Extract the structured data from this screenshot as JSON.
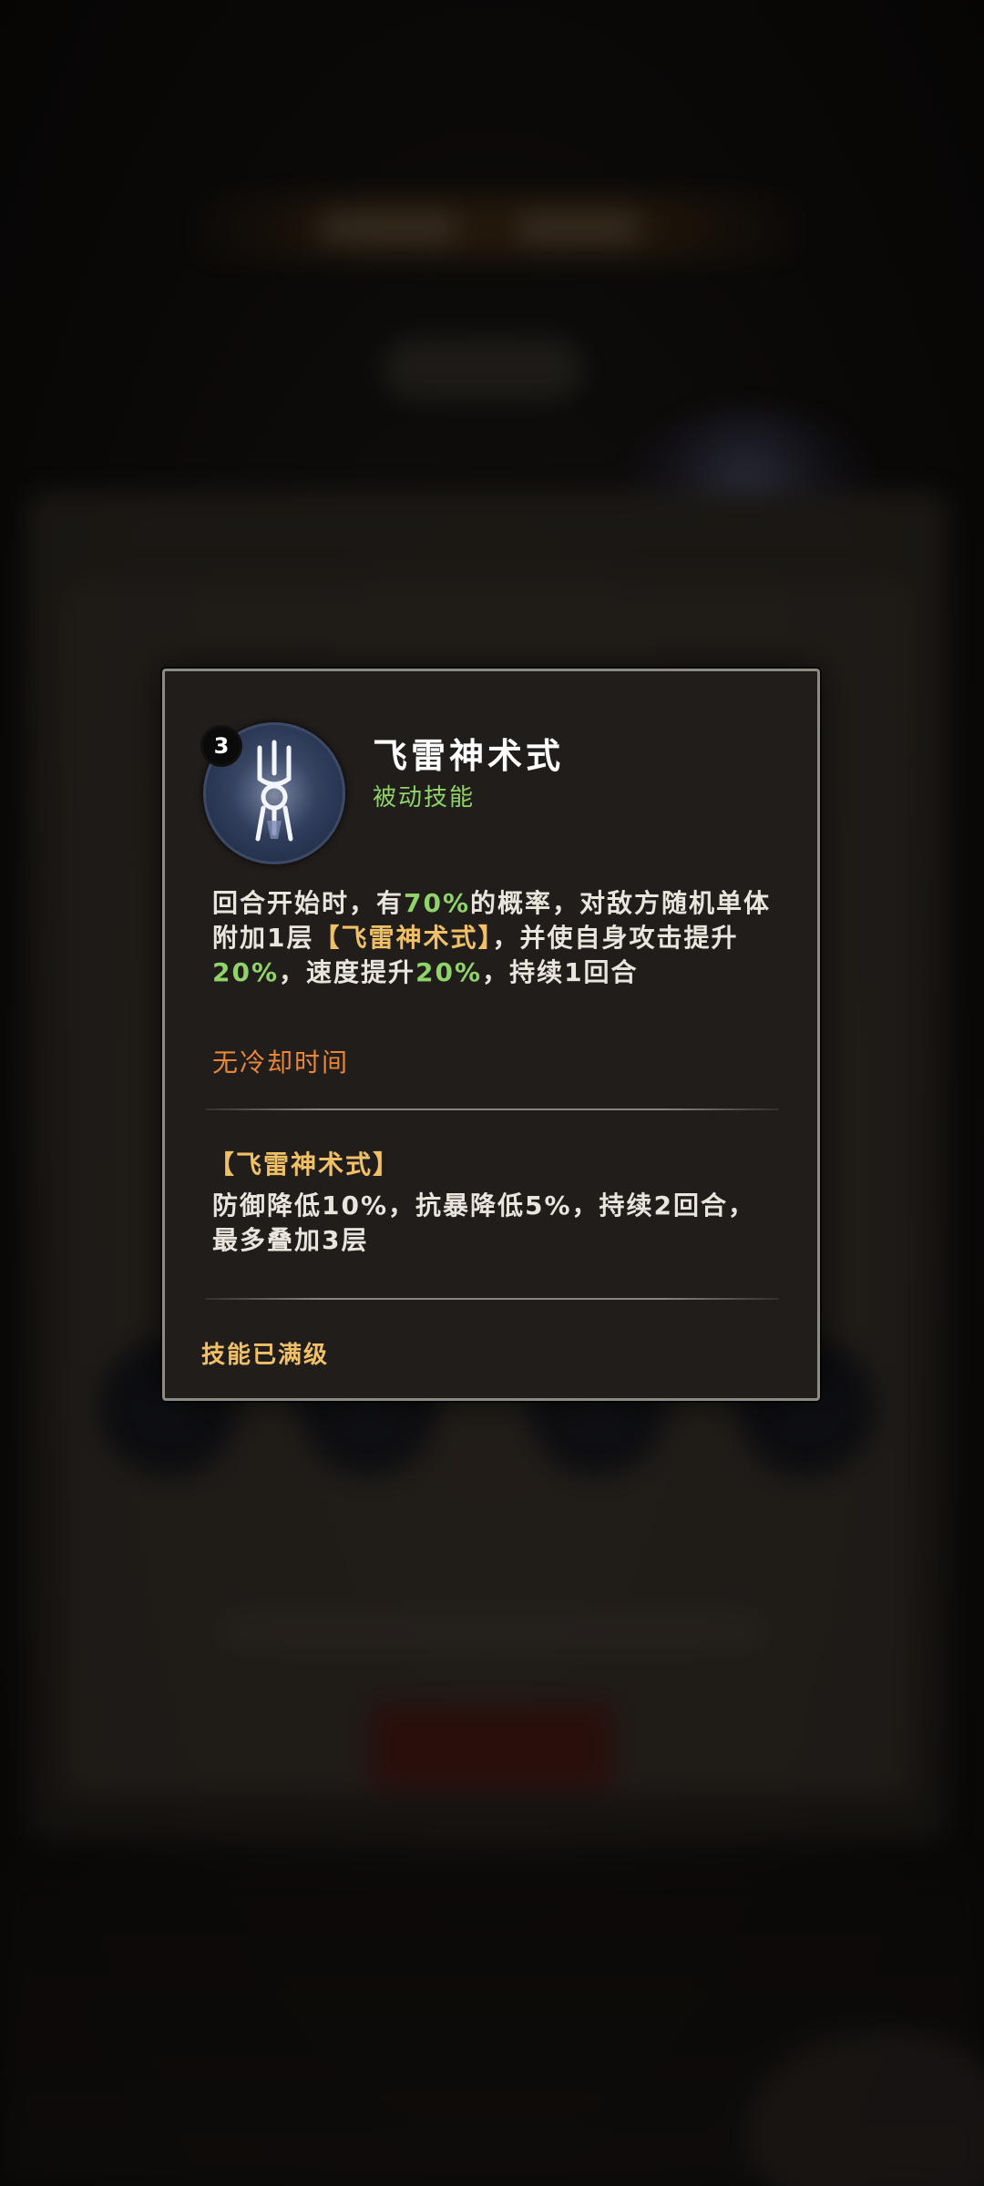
{
  "skill": {
    "level": "3",
    "name": "飞雷神术式",
    "type": "被动技能",
    "icon": "lightning-totem-icon",
    "description": {
      "p1": "回合开始时，有",
      "rate": "70%",
      "p2": "的概率，对敌方随机单体附加1层",
      "effect_tag": "【飞雷神术式】",
      "p3": "，并使自身攻击提升",
      "atk_up": "20%",
      "p4": "，速度提升",
      "spd_up": "20%",
      "p5": "，持续1回合"
    },
    "cooldown": "无冷却时间",
    "effect": {
      "name": "【飞雷神术式】",
      "description": "防御降低10%，抗暴降低5%，持续2回合，最多叠加3层"
    },
    "status": "技能已满级"
  },
  "colors": {
    "highlight_green": "#8fd36a",
    "highlight_gold": "#f0c067",
    "cooldown_orange": "#e8873a",
    "card_border": "#8e8a84"
  }
}
